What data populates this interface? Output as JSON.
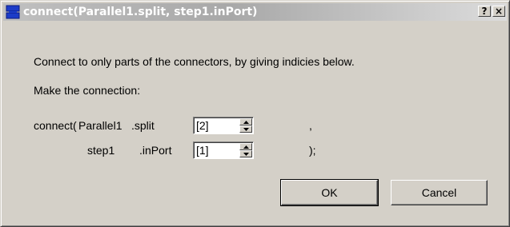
{
  "window": {
    "title": "connect(Parallel1.split, step1.inPort)",
    "help_label": "?",
    "close_label": "×"
  },
  "content": {
    "instruction": "Connect to only parts of the connectors, by giving indicies below.",
    "make_label": "Make the connection:",
    "row1": {
      "prefix": "connect(",
      "component": "Parallel1",
      "port": ".split",
      "index_value": "[2]",
      "separator": ","
    },
    "row2": {
      "component": "step1",
      "port": ".inPort",
      "index_value": "[1]",
      "terminator": ");"
    }
  },
  "buttons": {
    "ok_label": "OK",
    "cancel_label": "Cancel"
  },
  "icons": {
    "app": "modelica-connect-icon",
    "spin_up": "up-arrow-icon",
    "spin_down": "down-arrow-icon"
  },
  "colors": {
    "titlebar_start": "#c0c0c0",
    "titlebar_end": "#dcdcdc",
    "face": "#d4d0c8",
    "icon_blue": "#1c3cc8"
  }
}
